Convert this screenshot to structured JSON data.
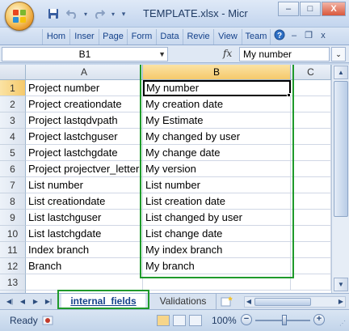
{
  "window": {
    "title": "TEMPLATE.xlsx - Micr",
    "minimize_label": "–",
    "maximize_label": "□",
    "close_label": "X"
  },
  "quick_access": {
    "save_icon": "save-icon",
    "undo_icon": "undo-icon",
    "redo_icon": "redo-icon"
  },
  "ribbon": {
    "tabs": [
      "Hom",
      "Inser",
      "Page",
      "Form",
      "Data",
      "Revie",
      "View",
      "Team"
    ],
    "help_label": "?",
    "min_label": "–",
    "close_label": "x"
  },
  "formula_bar": {
    "name_box": "B1",
    "fx_label": "fx",
    "value": "My number"
  },
  "grid": {
    "columns": [
      "A",
      "B",
      "C"
    ],
    "selected_column": "B",
    "selected_row": 1,
    "rows": [
      {
        "num": "1",
        "a": "Project number",
        "b": "My number"
      },
      {
        "num": "2",
        "a": "Project creationdate",
        "b": "My creation date"
      },
      {
        "num": "3",
        "a": "Project lastqdvpath",
        "b": "My Estimate"
      },
      {
        "num": "4",
        "a": "Project lastchguser",
        "b": "My changed by user"
      },
      {
        "num": "5",
        "a": "Project lastchgdate",
        "b": "My change date"
      },
      {
        "num": "6",
        "a": "Project projectver_letter",
        "b": "My version"
      },
      {
        "num": "7",
        "a": "List number",
        "b": "List number"
      },
      {
        "num": "8",
        "a": "List creationdate",
        "b": "List creation date"
      },
      {
        "num": "9",
        "a": "List lastchguser",
        "b": "List changed by user"
      },
      {
        "num": "10",
        "a": "List lastchgdate",
        "b": "List change date"
      },
      {
        "num": "11",
        "a": "Index branch",
        "b": "My index branch"
      },
      {
        "num": "12",
        "a": "Branch",
        "b": "My branch"
      },
      {
        "num": "13",
        "a": "",
        "b": ""
      }
    ]
  },
  "sheets": {
    "tabs": [
      "internal_fields",
      "Validations"
    ],
    "active": "internal_fields"
  },
  "status": {
    "text": "Ready",
    "zoom": "100%",
    "zoom_out_label": "−",
    "zoom_in_label": "+"
  },
  "colors": {
    "highlight": "#1f9a2b",
    "header_selected": "#f5c96b",
    "office_orange": "#e58d1c"
  }
}
